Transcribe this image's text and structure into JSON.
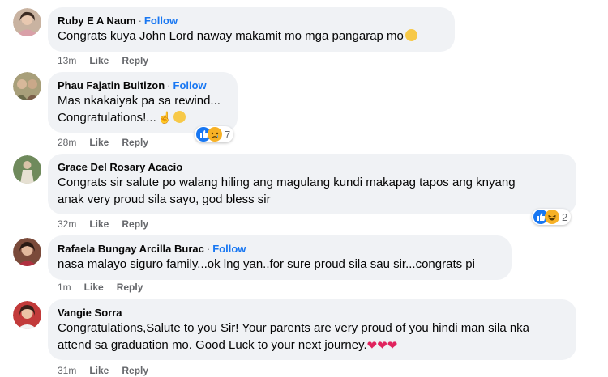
{
  "colors": {
    "bubble": "#f0f2f5",
    "follow": "#1877f2",
    "meta": "#65676b",
    "like": "#1877f2",
    "haha": "#f7b125"
  },
  "comments": [
    {
      "name": "Ruby E A Naum",
      "sep": "·",
      "follow": "Follow",
      "lines": [
        "Congrats kuya John Lord naway makamit mo mga pangarap mo"
      ],
      "emoji_after": "grinning-face-emoji",
      "time": "13m",
      "like": "Like",
      "reply": "Reply"
    },
    {
      "name": "Phau Fajatin Buitizon",
      "sep": "·",
      "follow": "Follow",
      "lines": [
        "Mas nkakaiyak pa sa rewind...",
        "Congratulations!..."
      ],
      "emoji_after": "finger-and-smiling-face-emoji",
      "time": "28m",
      "like": "Like",
      "reply": "Reply",
      "reactions": {
        "icons": [
          "like-icon",
          "sad-icon"
        ],
        "count": "7"
      }
    },
    {
      "name": "Grace Del Rosary Acacio",
      "lines": [
        "Congrats sir salute po walang hiling ang magulang kundi makapag tapos ang knyang",
        "anak very proud sila sayo, god bless sir"
      ],
      "time": "32m",
      "like": "Like",
      "reply": "Reply",
      "reactions": {
        "icons": [
          "like-icon",
          "haha-icon"
        ],
        "count": "2"
      }
    },
    {
      "name": "Rafaela Bungay Arcilla Burac",
      "sep": "·",
      "follow": "Follow",
      "lines": [
        "nasa malayo siguro family...ok lng yan..for sure proud sila sau sir...congrats pi"
      ],
      "time": "1m",
      "like": "Like",
      "reply": "Reply"
    },
    {
      "name": "Vangie Sorra",
      "lines": [
        "Congratulations,Salute to you Sir! Your parents are very proud of you hindi man sila nka",
        "attend sa graduation mo. Good Luck to your next journey."
      ],
      "emoji_after": "heart-face-emojis",
      "time": "31m",
      "like": "Like",
      "reply": "Reply"
    }
  ]
}
